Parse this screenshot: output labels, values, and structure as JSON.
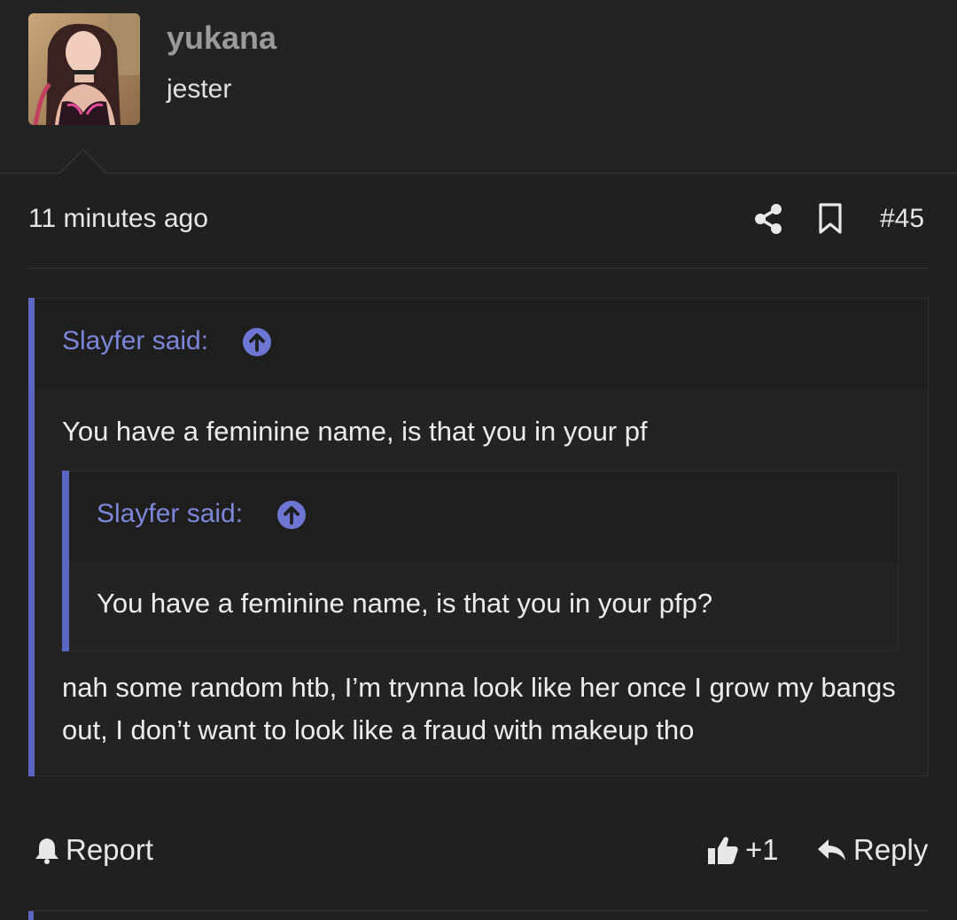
{
  "user": {
    "name": "yukana",
    "title": "jester",
    "avatar_icon": "avatar-photo"
  },
  "post": {
    "time": "11 minutes ago",
    "number": "#45",
    "share_icon": "share-icon",
    "bookmark_icon": "bookmark-icon"
  },
  "quote": {
    "attribution": "Slayfer said:",
    "text": "You have a feminine name, is that you in your pf",
    "nested": {
      "attribution": "Slayfer said:",
      "text": "You have a feminine name, is that you in your pfp?"
    }
  },
  "reply": {
    "text": "nah some random htb, I’m trynna look like her once I grow my bangs out, I don’t want to look like a fraud with makeup tho"
  },
  "actions": {
    "report_label": "Report",
    "like_label": "+1",
    "reply_label": "Reply"
  },
  "colors": {
    "accent": "#5c64c4",
    "link": "#7d86d8",
    "background": "#202020"
  }
}
